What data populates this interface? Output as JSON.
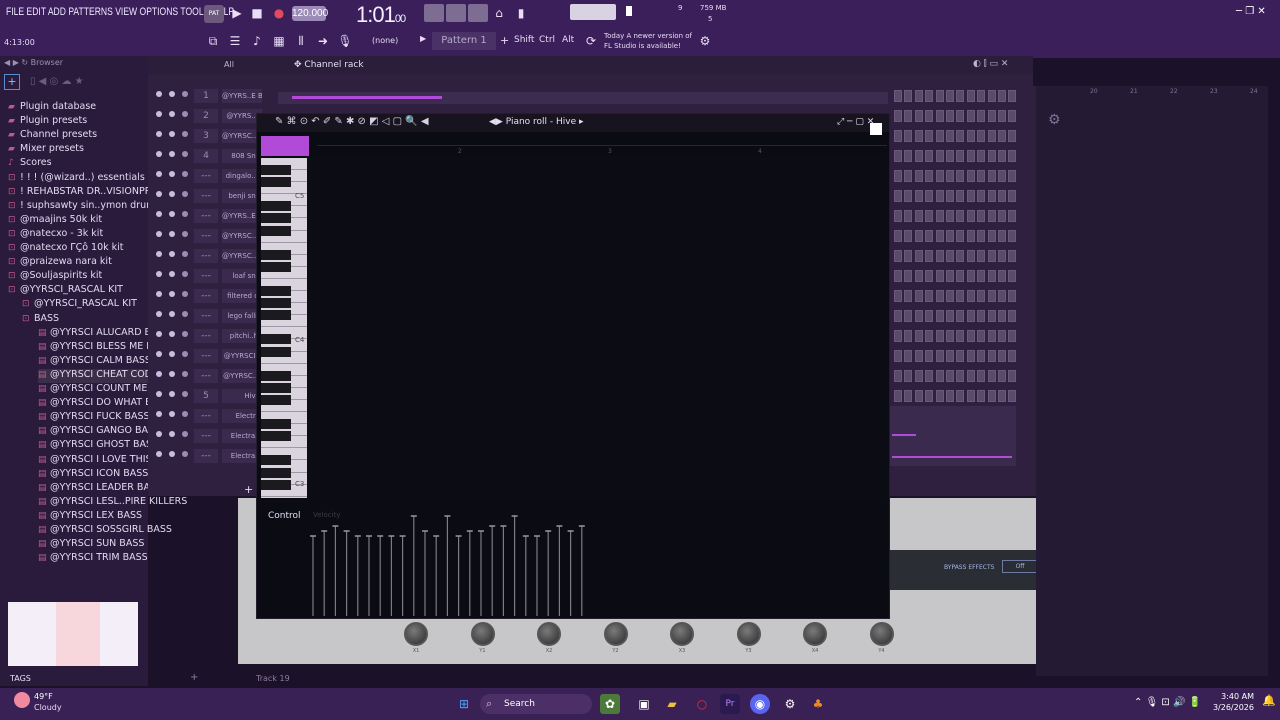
{
  "menu": [
    "FILE",
    "EDIT",
    "ADD",
    "PATTERNS",
    "VIEW",
    "OPTIONS",
    "TOOLS",
    "HELP"
  ],
  "transport": {
    "tempo": "120.000",
    "time": "1:01",
    "time_sub": "00",
    "memory": "759 MB",
    "cpu_top": "9",
    "cpu_bottom": "5",
    "song_pos": "4:13:00"
  },
  "toolbar": {
    "none_label": "(none)",
    "pattern": "Pattern 1",
    "shift": "Shift",
    "ctrl": "Ctrl",
    "alt": "Alt"
  },
  "news": {
    "line1": "Today  A newer version of",
    "line2": "FL Studio is available!"
  },
  "browser": {
    "title": "Browser",
    "filter": "All",
    "items": [
      {
        "label": "Plugin database",
        "icon": "plugin-icon"
      },
      {
        "label": "Plugin presets",
        "icon": "plugin-icon"
      },
      {
        "label": "Channel presets",
        "icon": "plugin-icon"
      },
      {
        "label": "Mixer presets",
        "icon": "plugin-icon"
      },
      {
        "label": "Scores",
        "icon": "note-icon"
      },
      {
        "label": "! ! ! (@wizard..) essentials kit",
        "icon": "folder-icon"
      },
      {
        "label": "! REHABSTAR DR..VISIONPROD1",
        "icon": "folder-icon"
      },
      {
        "label": "! suphsawty sin..ymon drum-kit",
        "icon": "folder-icon"
      },
      {
        "label": "@maajins 50k kit",
        "icon": "folder-icon"
      },
      {
        "label": "@natecxo - 3k kit",
        "icon": "folder-icon"
      },
      {
        "label": "@natecxo ΓÇô 10k kit",
        "icon": "folder-icon"
      },
      {
        "label": "@praizewa nara kit",
        "icon": "folder-icon"
      },
      {
        "label": "@Souljaspirits kit",
        "icon": "folder-icon"
      },
      {
        "label": "@YYRSCI_RASCAL KIT",
        "icon": "folder-icon"
      },
      {
        "label": "@YYRSCI_RASCAL KIT",
        "icon": "folder-icon"
      },
      {
        "label": "BASS",
        "icon": "folder-icon"
      },
      {
        "label": "@YYRSCI ALUCARD BASS",
        "icon": "file-icon"
      },
      {
        "label": "@YYRSCI BLESS ME BASS",
        "icon": "file-icon"
      },
      {
        "label": "@YYRSCI CALM BASS",
        "icon": "file-icon"
      },
      {
        "label": "@YYRSCI CHEAT CODE BASS",
        "icon": "file-icon"
      },
      {
        "label": "@YYRSCI COUNT ME IN BASS",
        "icon": "file-icon"
      },
      {
        "label": "@YYRSCI DO WHAT BASS",
        "icon": "file-icon"
      },
      {
        "label": "@YYRSCI FUCK BASS",
        "icon": "file-icon"
      },
      {
        "label": "@YYRSCI GANGO BASS",
        "icon": "file-icon"
      },
      {
        "label": "@YYRSCI GHOST BASS",
        "icon": "file-icon"
      },
      {
        "label": "@YYRSCI I LOVE THIS BASS",
        "icon": "file-icon"
      },
      {
        "label": "@YYRSCI ICON BASS",
        "icon": "file-icon"
      },
      {
        "label": "@YYRSCI LEADER BASS",
        "icon": "file-icon"
      },
      {
        "label": "@YYRSCI LESL..PIRE KILLERS",
        "icon": "file-icon"
      },
      {
        "label": "@YYRSCI LEX BASS",
        "icon": "file-icon"
      },
      {
        "label": "@YYRSCI SOSSGIRL BASS",
        "icon": "file-icon"
      },
      {
        "label": "@YYRSCI SUN BASS",
        "icon": "file-icon"
      },
      {
        "label": "@YYRSCI TRIM BASS",
        "icon": "file-icon"
      }
    ],
    "tags": "TAGS"
  },
  "channel_rack": {
    "title": "Channel rack",
    "channels": [
      {
        "num": "1",
        "name": "@YYRS..E BASS"
      },
      {
        "num": "2",
        "name": "@YYRS..Y"
      },
      {
        "num": "3",
        "name": "@YYRSC..L"
      },
      {
        "num": "4",
        "name": "808 Sna"
      },
      {
        "num": "---",
        "name": "dingalo..a"
      },
      {
        "num": "---",
        "name": "benji sna"
      },
      {
        "num": "---",
        "name": "@YYRS..EN"
      },
      {
        "num": "---",
        "name": "@YYRSC..B"
      },
      {
        "num": "---",
        "name": "@YYRSC..D"
      },
      {
        "num": "---",
        "name": "loaf sna"
      },
      {
        "num": "---",
        "name": "filtered cl"
      },
      {
        "num": "---",
        "name": "lego fallir"
      },
      {
        "num": "---",
        "name": "pitchi..hi"
      },
      {
        "num": "---",
        "name": "@YYRSCI.."
      },
      {
        "num": "---",
        "name": "@YYRSC..[",
        "note": ""
      },
      {
        "num": "5",
        "name": "Hive"
      },
      {
        "num": "---",
        "name": "Electra"
      },
      {
        "num": "---",
        "name": "ElectraX"
      },
      {
        "num": "---",
        "name": "ElectraX"
      }
    ]
  },
  "piano_roll": {
    "title": "Piano roll - Hive",
    "bars": [
      "2",
      "3",
      "4"
    ],
    "octaves": [
      "C5",
      "C4",
      "C3"
    ],
    "control": "Control",
    "velocity": "Velocity",
    "velocities": [
      0.8,
      0.85,
      0.9,
      0.85,
      0.8,
      0.8,
      0.8,
      0.8,
      0.8,
      1.0,
      0.85,
      0.8,
      1.0,
      0.8,
      0.85,
      0.85,
      0.9,
      0.9,
      1.0,
      0.8,
      0.8,
      0.85,
      0.9,
      0.85,
      0.9
    ]
  },
  "plugin": {
    "bypass": "BYPASS EFFECTS",
    "off": "Off",
    "knobs": [
      "X1",
      "Y1",
      "X2",
      "Y2",
      "X3",
      "Y3",
      "X4",
      "Y4"
    ]
  },
  "playlist_ticks": [
    "20",
    "21",
    "22",
    "23",
    "24"
  ],
  "status": {
    "track": "Track 19"
  },
  "taskbar": {
    "temp": "49°F",
    "weather": "Cloudy",
    "search": "Search",
    "clock": "3:40 AM",
    "date": "3/26/2026"
  }
}
